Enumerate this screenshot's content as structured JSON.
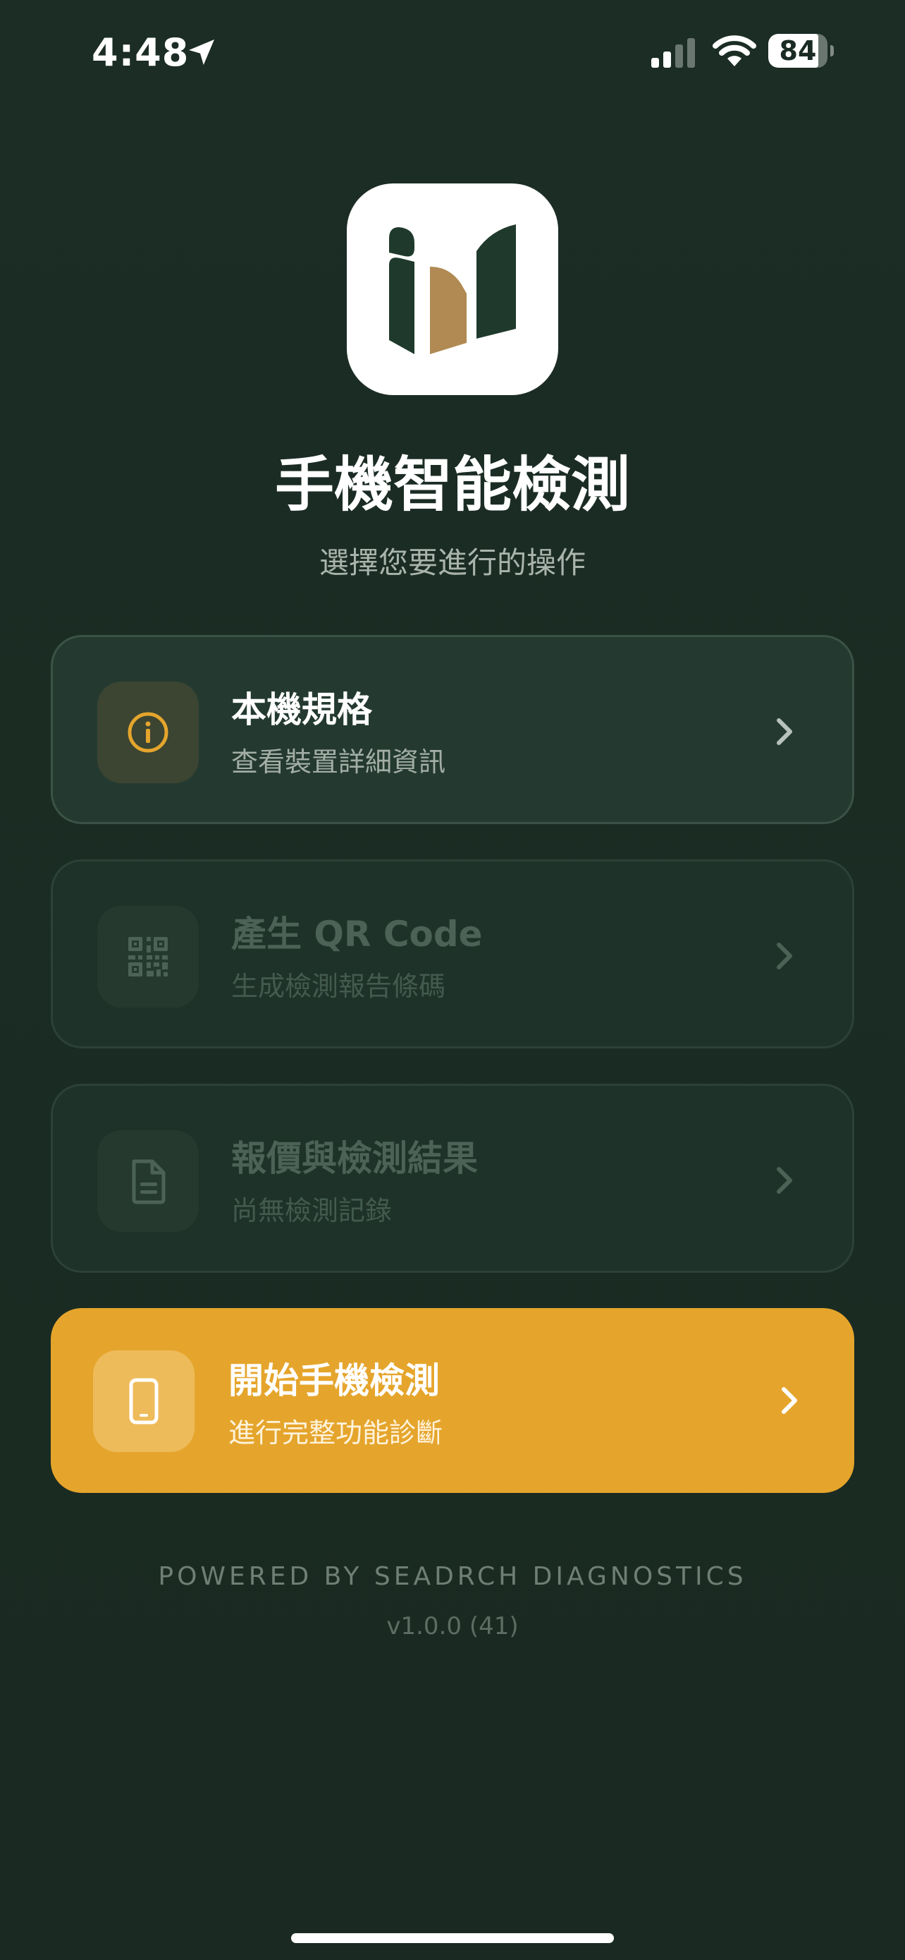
{
  "status_bar": {
    "time": "4:48",
    "battery": "84",
    "battery_level": 0.84
  },
  "header": {
    "title": "手機智能檢測",
    "subtitle": "選擇您要進行的操作"
  },
  "menu": {
    "items": [
      {
        "title": "本機規格",
        "description": "查看裝置詳細資訊",
        "icon": "info-icon",
        "enabled": true
      },
      {
        "title": "產生 QR Code",
        "description": "生成檢測報告條碼",
        "icon": "qr-code-icon",
        "enabled": false
      },
      {
        "title": "報價與檢測結果",
        "description": "尚無檢測記錄",
        "icon": "document-icon",
        "enabled": false
      },
      {
        "title": "開始手機檢測",
        "description": "進行完整功能診斷",
        "icon": "phone-icon",
        "enabled": true
      }
    ]
  },
  "footer": {
    "powered_by": "POWERED BY SEADRCH DIAGNOSTICS",
    "version": "v1.0.0 (41)"
  },
  "colors": {
    "background": "#1a2b23",
    "accent": "#e5a52c",
    "card": "#243a30",
    "logo_green": "#1f3a2c",
    "logo_gold": "#b08a52"
  }
}
